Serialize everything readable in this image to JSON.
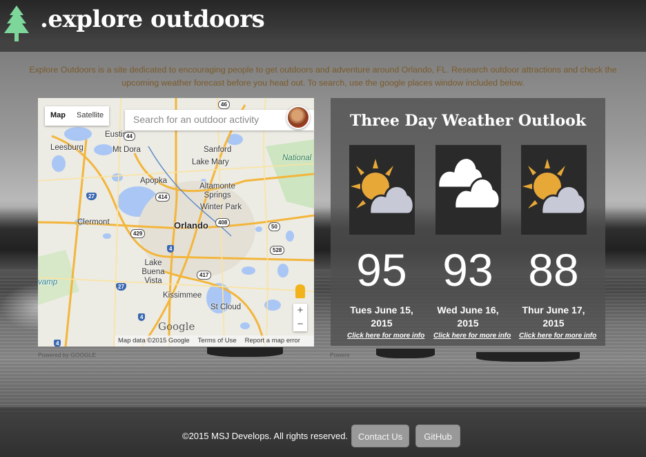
{
  "header": {
    "brand": ".explore outdoors"
  },
  "intro": "Explore Outdoors is a site dedicated to encouraging people to get outdoors and adventure around Orlando, FL. Research outdoor attractions and check the upcoming weather forecast before you head out. To search, use the google places window included below.",
  "map": {
    "type_tabs": [
      "Map",
      "Satellite"
    ],
    "active_tab": "Map",
    "search_placeholder": "Search for an outdoor activity",
    "places": [
      "Eustis",
      "Leesburg",
      "Mt Dora",
      "Sanford",
      "Lake Mary",
      "Apopka",
      "Altamonte Springs",
      "Winter Park",
      "Clermont",
      "Orlando",
      "Lake Buena Vista",
      "Kissimmee",
      "St Cloud"
    ],
    "water_labels": [
      "vamp"
    ],
    "green_labels": [
      "National S"
    ],
    "road_shields": [
      "44",
      "46",
      "27",
      "414",
      "408",
      "50",
      "429",
      "528",
      "417",
      "27",
      "4",
      "4",
      "4"
    ],
    "logo": "Google",
    "footer": [
      "Map data ©2015 Google",
      "Terms of Use",
      "Report a map error"
    ],
    "powered_by": "Powered by GOOGLE",
    "zoom_in": "+",
    "zoom_out": "−"
  },
  "weather": {
    "title": "Three Day Weather Outlook",
    "days": [
      {
        "icon": "partly-cloudy-icon",
        "temp": "95",
        "date": "Tues June 15, 2015",
        "link": "Click here for more info"
      },
      {
        "icon": "cloudy-icon",
        "temp": "93",
        "date": "Wed June 16, 2015",
        "link": "Click here for more info"
      },
      {
        "icon": "partly-cloudy-icon",
        "temp": "88",
        "date": "Thur June 17, 2015",
        "link": "Click here for more info"
      }
    ],
    "powered_by": "Powere"
  },
  "footer": {
    "copyright": "©2015 MSJ Develops. All rights reserved.",
    "contact": "Contact Us",
    "github": "GitHub"
  },
  "colors": {
    "accent_tree": "#7ed79a",
    "intro_text": "#7a5a2a",
    "sun": "#e8a838",
    "cloud": "#c8c9d6"
  }
}
